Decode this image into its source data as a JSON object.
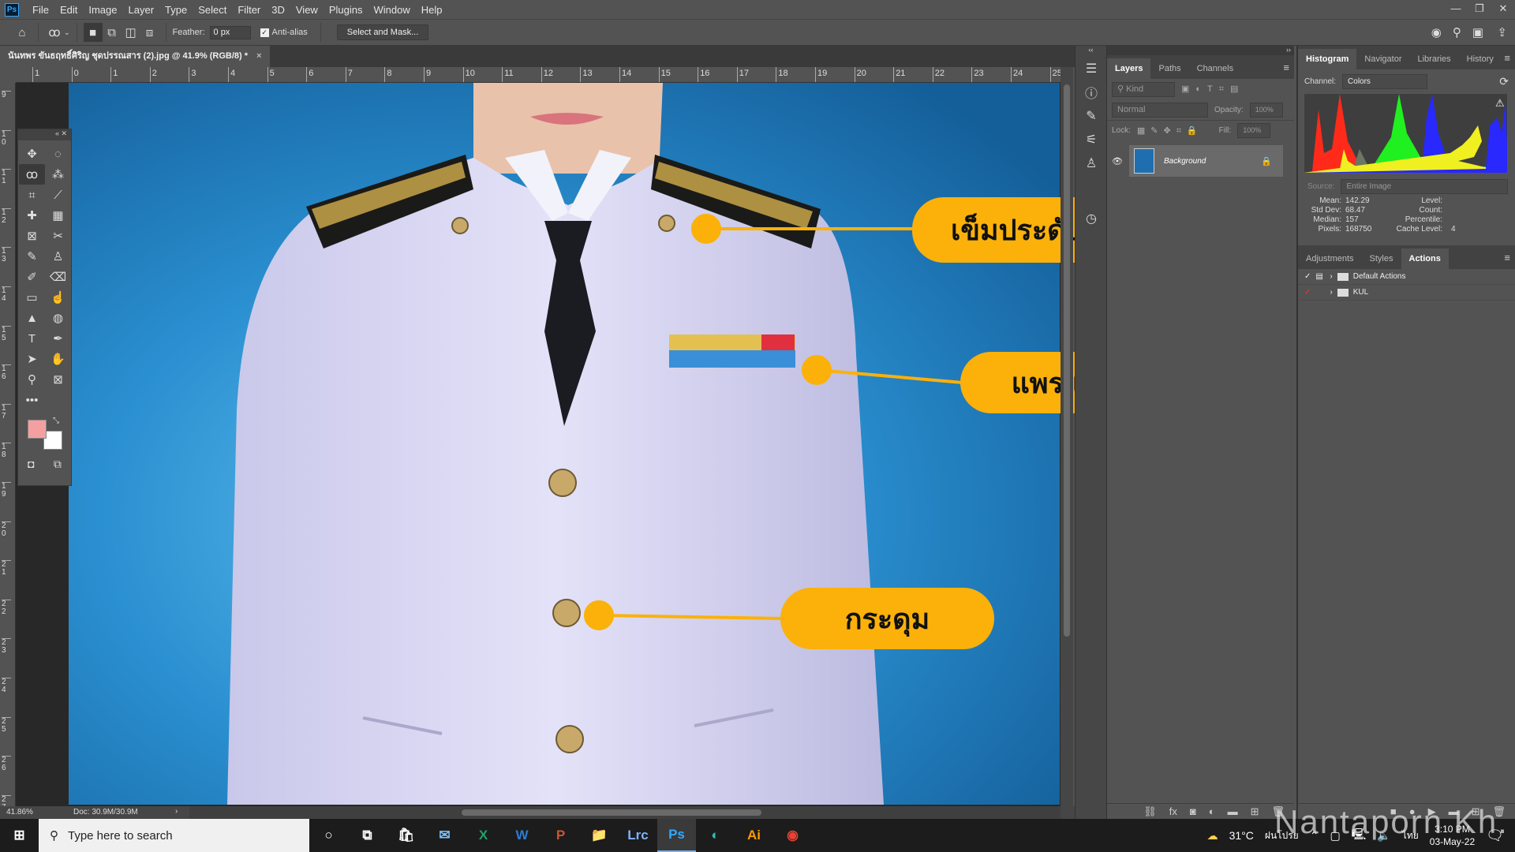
{
  "app": {
    "logo": "Ps",
    "menu": [
      "File",
      "Edit",
      "Image",
      "Layer",
      "Type",
      "Select",
      "Filter",
      "3D",
      "View",
      "Plugins",
      "Window",
      "Help"
    ],
    "window_controls": [
      "minimize",
      "restore",
      "close"
    ]
  },
  "options": {
    "feather_label": "Feather:",
    "feather_value": "0 px",
    "antialias_label": "Anti-alias",
    "antialias_checked": true,
    "select_mask": "Select and Mask..."
  },
  "document": {
    "tab_title": "นันทพร ขันธฤทธิ์ศิริญ ชุดปรรณสาร (2).jpg @ 41.9% (RGB/8) *",
    "close": "×"
  },
  "rulers": {
    "top": [
      "1",
      "0",
      "1",
      "2",
      "3",
      "4",
      "5",
      "6",
      "7",
      "8",
      "9",
      "10",
      "11",
      "12",
      "13",
      "14",
      "15",
      "16",
      "17",
      "18",
      "19",
      "20",
      "21",
      "22",
      "23",
      "24",
      "25"
    ],
    "left": [
      "9",
      "10",
      "11",
      "12",
      "13",
      "14",
      "15",
      "16",
      "17",
      "18",
      "19",
      "20",
      "21",
      "22",
      "23",
      "24",
      "25",
      "26",
      "27"
    ]
  },
  "tools": [
    {
      "name": "move",
      "g": "✥"
    },
    {
      "name": "marquee",
      "g": "◌"
    },
    {
      "name": "lasso",
      "g": "ꝏ"
    },
    {
      "name": "magic-wand",
      "g": "⁂"
    },
    {
      "name": "crop",
      "g": "⌗"
    },
    {
      "name": "eyedropper",
      "g": "⟋"
    },
    {
      "name": "healing",
      "g": "✚"
    },
    {
      "name": "patch",
      "g": "▦"
    },
    {
      "name": "frame",
      "g": "⊠"
    },
    {
      "name": "scissors",
      "g": "✂"
    },
    {
      "name": "brush",
      "g": "✎"
    },
    {
      "name": "stamp",
      "g": "♙"
    },
    {
      "name": "history-brush",
      "g": "✐"
    },
    {
      "name": "eraser",
      "g": "⌫"
    },
    {
      "name": "gradient",
      "g": "▭"
    },
    {
      "name": "smudge",
      "g": "☝"
    },
    {
      "name": "sharpen",
      "g": "▲"
    },
    {
      "name": "sponge",
      "g": "◍"
    },
    {
      "name": "type",
      "g": "T"
    },
    {
      "name": "pen",
      "g": "✒"
    },
    {
      "name": "path-select",
      "g": "➤"
    },
    {
      "name": "hand",
      "g": "✋"
    },
    {
      "name": "zoom",
      "g": "⚲"
    },
    {
      "name": "artboard",
      "g": "⊠"
    },
    {
      "name": "more",
      "g": "•••"
    }
  ],
  "colors": {
    "foreground": "#f4a0a0",
    "background": "#ffffff",
    "callout": "#fbb10a",
    "canvas_blue": "#1f7fc4"
  },
  "callouts": [
    {
      "text": "เข็มประดับปกเสื้อ"
    },
    {
      "text": "แพรแถบย่อ"
    },
    {
      "text": "กระดุม"
    }
  ],
  "status": {
    "zoom": "41.86%",
    "doc": "Doc: 30.9M/30.9M"
  },
  "layers_panel": {
    "tabs": [
      "Layers",
      "Paths",
      "Channels"
    ],
    "kind": "Kind",
    "blend": "Normal",
    "opacity_label": "Opacity:",
    "opacity": "100%",
    "lock_label": "Lock:",
    "fill_label": "Fill:",
    "fill": "100%",
    "layers": [
      {
        "name": "Background",
        "visible": true,
        "locked": true
      }
    ]
  },
  "histogram_panel": {
    "tabs": [
      "Histogram",
      "Navigator",
      "Libraries",
      "History"
    ],
    "channel_label": "Channel:",
    "channel": "Colors",
    "source_label": "Source:",
    "source": "Entire Image",
    "stats": [
      {
        "label": "Mean:",
        "value": "142.29"
      },
      {
        "label": "Std Dev:",
        "value": "68.47"
      },
      {
        "label": "Median:",
        "value": "157"
      },
      {
        "label": "Pixels:",
        "value": "168750"
      }
    ],
    "stats_right": [
      {
        "label": "Level:",
        "value": ""
      },
      {
        "label": "Count:",
        "value": ""
      },
      {
        "label": "Percentile:",
        "value": ""
      },
      {
        "label": "Cache Level:",
        "value": "4"
      }
    ]
  },
  "actions_panel": {
    "tabs": [
      "Adjustments",
      "Styles",
      "Actions"
    ],
    "items": [
      {
        "name": "Default Actions"
      },
      {
        "name": "KUL"
      }
    ]
  },
  "taskbar": {
    "search_placeholder": "Type here to search",
    "apps": [
      "Store",
      "Mail",
      "Excel",
      "Word",
      "PowerPoint",
      "File Explorer",
      "Lrc",
      "Ps",
      "Edge",
      "Ai",
      "Chrome"
    ],
    "weather": "31°C",
    "weather_desc": "ฝนโปรย",
    "lang": "ไทย",
    "time": "3:10 PM",
    "date": "03-May-22",
    "mail_badge": "2"
  },
  "watermark": "Nantaporn Kh."
}
